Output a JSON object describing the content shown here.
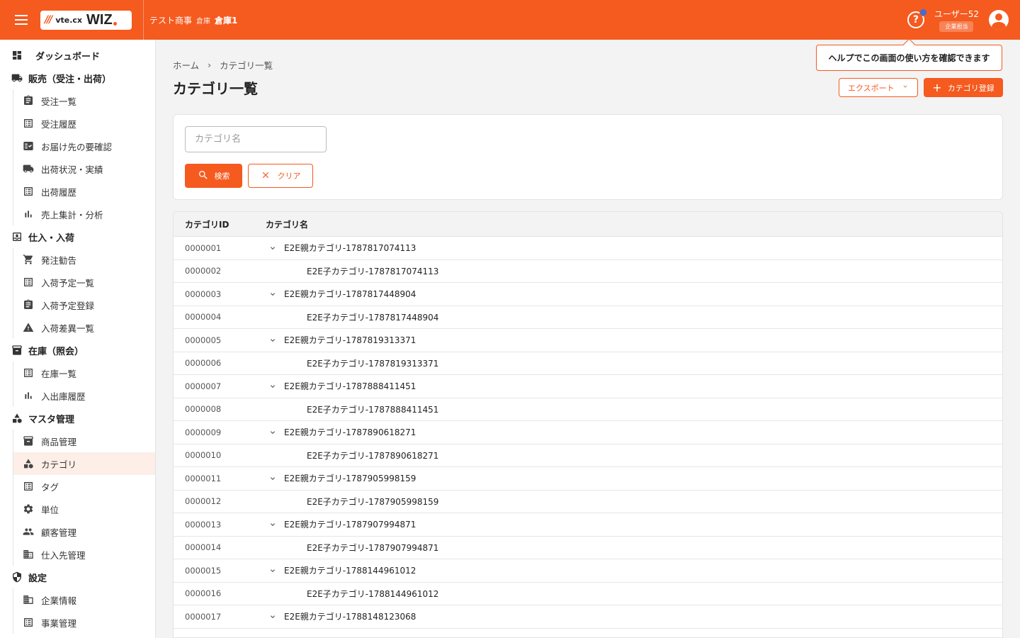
{
  "header": {
    "logo_vte": "vte.cx",
    "logo_wiz": "WIZ",
    "company": "テスト商事",
    "warehouse_label": "倉庫",
    "warehouse": "倉庫1",
    "user_name": "ユーザー52",
    "user_role": "企業担当",
    "accent_color": "#f55a1f"
  },
  "tooltip": {
    "text": "ヘルプでこの画面の使い方を確認できます"
  },
  "sidebar": {
    "dashboard": "ダッシュボード",
    "sales": {
      "label": "販売（受注・出荷）",
      "items": [
        "受注一覧",
        "受注履歴",
        "お届け先の要確認",
        "出荷状況・実績",
        "出荷履歴",
        "売上集計・分析"
      ]
    },
    "purchase": {
      "label": "仕入・入荷",
      "items": [
        "発注勧告",
        "入荷予定一覧",
        "入荷予定登録",
        "入荷差異一覧"
      ]
    },
    "stock": {
      "label": "在庫（照会）",
      "items": [
        "在庫一覧",
        "入出庫履歴"
      ]
    },
    "master": {
      "label": "マスタ管理",
      "items": [
        "商品管理",
        "カテゴリ",
        "タグ",
        "単位",
        "顧客管理",
        "仕入先管理"
      ]
    },
    "settings": {
      "label": "設定",
      "items": [
        "企業情報",
        "事業管理"
      ]
    }
  },
  "breadcrumb": {
    "home": "ホーム",
    "current": "カテゴリ一覧"
  },
  "page": {
    "title": "カテゴリ一覧"
  },
  "toolbar": {
    "export_label": "エクスポート",
    "register_label": "カテゴリ登録"
  },
  "search": {
    "placeholder": "カテゴリ名",
    "search_label": "検索",
    "clear_label": "クリア"
  },
  "table": {
    "headers": {
      "id": "カテゴリID",
      "name": "カテゴリ名"
    },
    "rows": [
      {
        "id": "0000001",
        "name": "E2E親カテゴリ-1787817074113",
        "parent": true
      },
      {
        "id": "0000002",
        "name": "E2E子カテゴリ-1787817074113",
        "parent": false
      },
      {
        "id": "0000003",
        "name": "E2E親カテゴリ-1787817448904",
        "parent": true
      },
      {
        "id": "0000004",
        "name": "E2E子カテゴリ-1787817448904",
        "parent": false
      },
      {
        "id": "0000005",
        "name": "E2E親カテゴリ-1787819313371",
        "parent": true
      },
      {
        "id": "0000006",
        "name": "E2E子カテゴリ-1787819313371",
        "parent": false
      },
      {
        "id": "0000007",
        "name": "E2E親カテゴリ-1787888411451",
        "parent": true
      },
      {
        "id": "0000008",
        "name": "E2E子カテゴリ-1787888411451",
        "parent": false
      },
      {
        "id": "0000009",
        "name": "E2E親カテゴリ-1787890618271",
        "parent": true
      },
      {
        "id": "0000010",
        "name": "E2E子カテゴリ-1787890618271",
        "parent": false
      },
      {
        "id": "0000011",
        "name": "E2E親カテゴリ-1787905998159",
        "parent": true
      },
      {
        "id": "0000012",
        "name": "E2E子カテゴリ-1787905998159",
        "parent": false
      },
      {
        "id": "0000013",
        "name": "E2E親カテゴリ-1787907994871",
        "parent": true
      },
      {
        "id": "0000014",
        "name": "E2E子カテゴリ-1787907994871",
        "parent": false
      },
      {
        "id": "0000015",
        "name": "E2E親カテゴリ-1788144961012",
        "parent": true
      },
      {
        "id": "0000016",
        "name": "E2E子カテゴリ-1788144961012",
        "parent": false
      },
      {
        "id": "0000017",
        "name": "E2E親カテゴリ-1788148123068",
        "parent": true
      }
    ]
  }
}
